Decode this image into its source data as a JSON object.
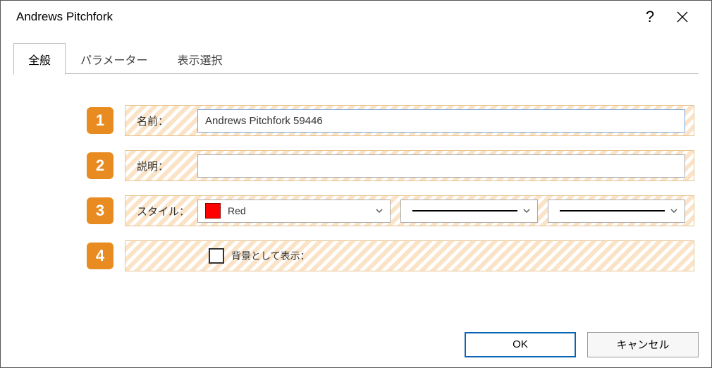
{
  "window": {
    "title": "Andrews Pitchfork"
  },
  "tabs": {
    "general": "全般",
    "parameters": "パラメーター",
    "visibility": "表示選択"
  },
  "rows": {
    "r1": {
      "badge": "1",
      "label": "名前：",
      "value": "Andrews Pitchfork 59446"
    },
    "r2": {
      "badge": "2",
      "label": "説明：",
      "value": ""
    },
    "r3": {
      "badge": "3",
      "label": "スタイル：",
      "color_name": "Red"
    },
    "r4": {
      "badge": "4",
      "checkbox_label": "背景として表示："
    }
  },
  "buttons": {
    "ok": "OK",
    "cancel": "キャンセル"
  }
}
